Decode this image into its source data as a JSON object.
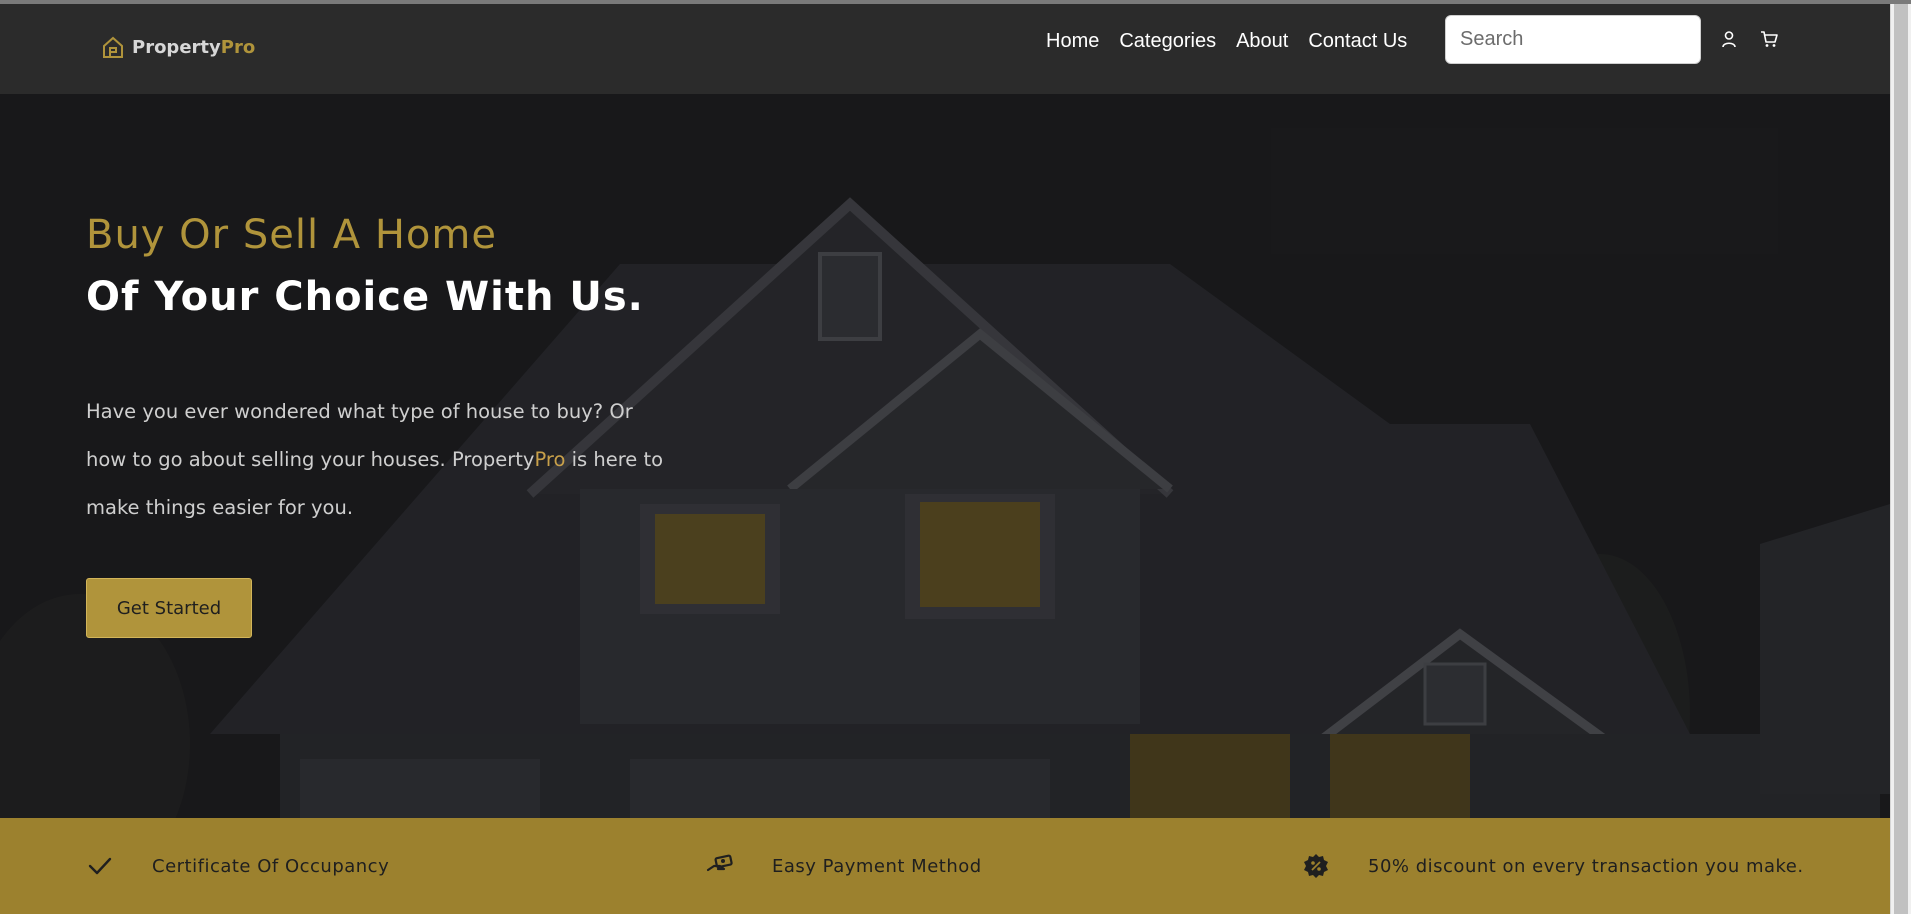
{
  "header": {
    "logo": {
      "part1": "Property",
      "part2": "Pro"
    },
    "nav": [
      {
        "label": "Home"
      },
      {
        "label": "Categories"
      },
      {
        "label": "About"
      },
      {
        "label": "Contact Us"
      }
    ],
    "search_placeholder": "Search",
    "icons": [
      "user-icon",
      "cart-icon"
    ]
  },
  "hero": {
    "headline_1": "Buy Or Sell A Home",
    "headline_2": "Of Your Choice With Us.",
    "text_before": "Have you ever wondered what type of house to buy? Or how to go about selling your houses. ",
    "text_brand_a": "Property",
    "text_brand_b": "Pro",
    "text_after": " is here to make things easier for you.",
    "cta_label": "Get Started"
  },
  "features": [
    {
      "icon": "check-icon",
      "label": "Certificate Of Occupancy"
    },
    {
      "icon": "hand-money-icon",
      "label": "Easy Payment Method"
    },
    {
      "icon": "discount-badge-icon",
      "label": "50% discount on every transaction you make."
    }
  ],
  "colors": {
    "accent": "#b0943b",
    "header_bg": "#2b2b2b",
    "hero_bg": "#1e1e20",
    "feature_bar": "#9c812e"
  }
}
